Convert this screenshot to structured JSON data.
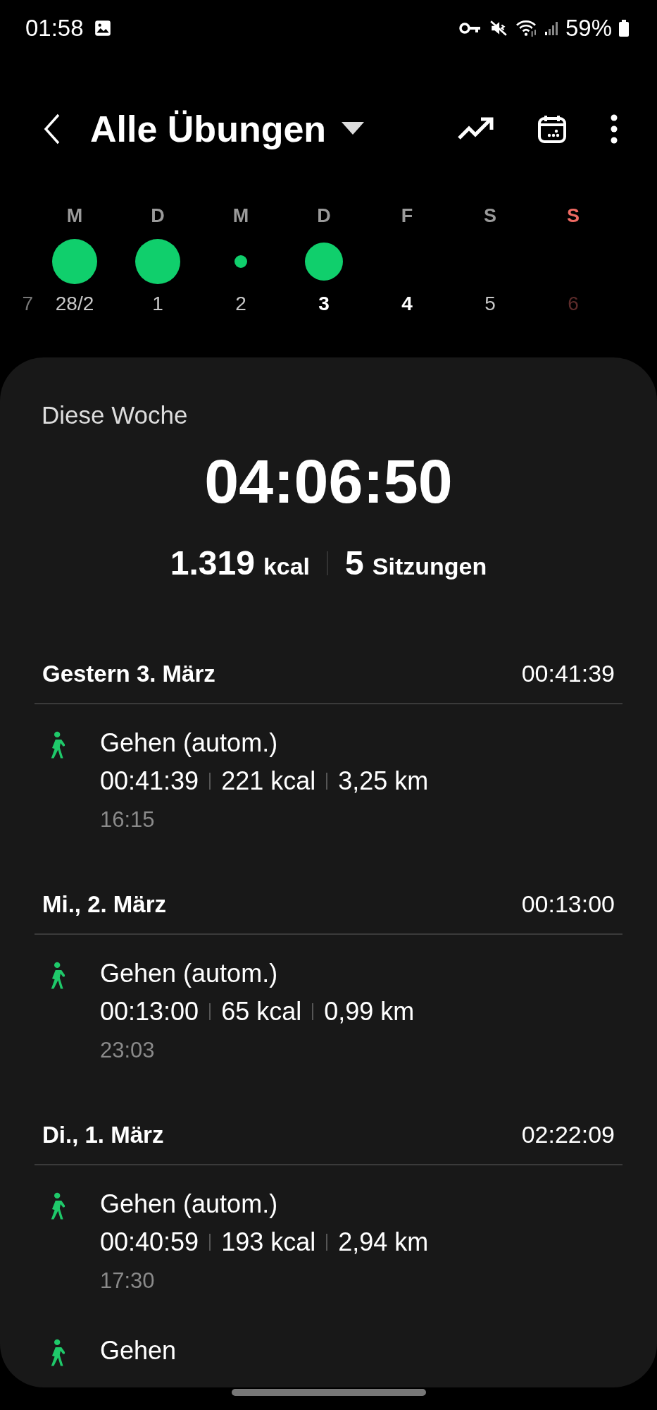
{
  "status_bar": {
    "time": "01:58",
    "battery": "59%"
  },
  "header": {
    "title": "Alle Übungen"
  },
  "week": [
    {
      "number": "7",
      "bold": false,
      "sunday": false
    },
    {
      "letter": "M",
      "number": "28/2",
      "kind": "large",
      "bold": false,
      "sunday": false
    },
    {
      "letter": "D",
      "number": "1",
      "kind": "large",
      "bold": false,
      "sunday": false
    },
    {
      "letter": "M",
      "number": "2",
      "kind": "small",
      "bold": false,
      "sunday": false
    },
    {
      "letter": "D",
      "number": "3",
      "kind": "medium",
      "bold": true,
      "sunday": false
    },
    {
      "letter": "F",
      "number": "4",
      "bold": true,
      "sunday": false
    },
    {
      "letter": "S",
      "number": "5",
      "bold": false,
      "sunday": false
    },
    {
      "letter": "S",
      "number": "6",
      "bold": false,
      "sunday": true
    }
  ],
  "summary": {
    "label": "Diese Woche",
    "total_time": "04:06:50",
    "calories": "1.319",
    "calories_unit": "kcal",
    "sessions": "5",
    "sessions_unit": "Sitzungen"
  },
  "days": [
    {
      "title": "Gestern 3. März",
      "total": "00:41:39",
      "entries": [
        {
          "name": "Gehen (autom.)",
          "duration": "00:41:39",
          "calories": "221 kcal",
          "distance": "3,25 km",
          "start": "16:15"
        }
      ]
    },
    {
      "title": "Mi., 2. März",
      "total": "00:13:00",
      "entries": [
        {
          "name": "Gehen (autom.)",
          "duration": "00:13:00",
          "calories": "65 kcal",
          "distance": "0,99 km",
          "start": "23:03"
        }
      ]
    },
    {
      "title": "Di., 1. März",
      "total": "02:22:09",
      "entries": [
        {
          "name": "Gehen (autom.)",
          "duration": "00:40:59",
          "calories": "193 kcal",
          "distance": "2,94 km",
          "start": "17:30"
        },
        {
          "name": "Gehen"
        }
      ]
    }
  ]
}
